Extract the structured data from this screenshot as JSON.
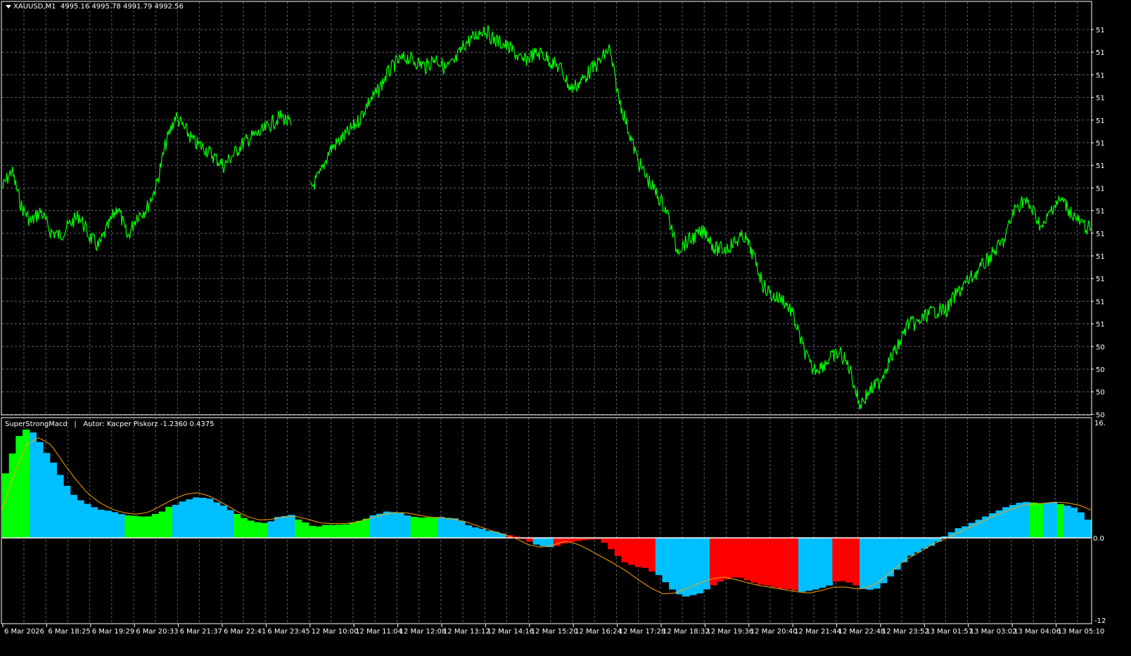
{
  "main": {
    "symbol_label": "XAUUSD,M1",
    "ohlc_label": "4995.16 4995.78 4991.79 4992.56",
    "price_axis_labels": [
      "51",
      "51",
      "51",
      "51",
      "51",
      "51",
      "51",
      "51",
      "51",
      "51",
      "51",
      "51",
      "51",
      "51",
      "50",
      "50",
      "50",
      "50",
      "50",
      "50"
    ],
    "line_color": "#00ff00"
  },
  "indicator": {
    "name_label": "SuperStrongMacd",
    "separator": "|",
    "info_label": "Autor: Kacper Piskorz -1.2360 0.4375",
    "axis_top": "16.",
    "axis_zero": "0.0",
    "axis_bottom": "-12",
    "colors": {
      "up_strong": "#00ff00",
      "weak": "#00bfff",
      "down_strong": "#ff0000",
      "signal": "#ffa500"
    }
  },
  "time_axis": [
    "6 Mar 2026",
    "6 Mar 18:25",
    "6 Mar 19:29",
    "6 Mar 20:33",
    "6 Mar 21:37",
    "6 Mar 22:41",
    "6 Mar 23:45",
    "12 Mar 10:00",
    "12 Mar 11:04",
    "12 Mar 12:08",
    "12 Mar 13:12",
    "12 Mar 14:16",
    "12 Mar 15:20",
    "12 Mar 16:24",
    "12 Mar 17:28",
    "12 Mar 18:32",
    "12 Mar 19:36",
    "12 Mar 20:40",
    "12 Mar 21:44",
    "12 Mar 22:48",
    "12 Mar 23:52",
    "13 Mar 01:57",
    "13 Mar 03:02",
    "13 Mar 04:06",
    "13 Mar 05:10"
  ],
  "chart_data": [
    {
      "type": "line",
      "title": "XAUUSD,M1",
      "series": [
        {
          "values": [
            5120,
            5128,
            5112,
            5105,
            5110,
            5101,
            5099,
            5104,
            5108,
            5099,
            5094,
            5103,
            5112,
            5098,
            5108,
            5111,
            5121,
            5140,
            5152,
            5146,
            5140,
            5138,
            5134,
            5130,
            5135,
            5140,
            5143,
            5145,
            5149,
            5152,
            5148,
            null,
            5120,
            5126,
            5137,
            5141,
            5145,
            5150,
            5158,
            5163,
            5171,
            5176,
            5178,
            5176,
            5174,
            5178,
            5173,
            5176,
            5184,
            5187,
            5191,
            5186,
            5184,
            5181,
            5176,
            5179,
            5180,
            5176,
            5173,
            5164,
            5167,
            5172,
            5176,
            5182,
            5160,
            5146,
            5132,
            5124,
            5117,
            5110,
            5093,
            5096,
            5099,
            5101,
            5093,
            5093,
            5096,
            5099,
            5090,
            5077,
            5072,
            5071,
            5065,
            5051,
            5040,
            5041,
            5045,
            5047,
            5040,
            5024,
            5030,
            5034,
            5043,
            5050,
            5060,
            5060,
            5064,
            5066,
            5066,
            5073,
            5078,
            5082,
            5087,
            5092,
            5097,
            5110,
            5115,
            5110,
            5102,
            5112,
            5115,
            5109,
            5104,
            5102
          ]
        }
      ],
      "x_start_label": "6 Mar 2026",
      "x_end_label": "13 Mar 05:10"
    },
    {
      "type": "area",
      "title": "SuperStrongMacd",
      "ylim": [
        -12,
        16
      ],
      "series": [
        {
          "values": [
            9,
            14,
            15.5,
            13,
            10.5,
            7.5,
            5.5,
            4.6,
            4,
            3.6,
            3.2,
            3.0,
            3.0,
            3.6,
            4.5,
            5.1,
            5.7,
            5.6,
            4.8,
            3.8,
            2.8,
            2.2,
            2.1,
            3.0,
            3.2,
            2.2,
            1.6,
            1.8,
            1.9,
            2.0,
            2.4,
            3.3,
            3.6,
            3.6,
            3.0,
            2.8,
            2.8,
            2.9,
            2.6,
            1.7,
            1.3,
            0.9,
            0.5,
            0.1,
            -0.5,
            -1.2,
            -1.5,
            -0.8,
            -0.5,
            -0.3,
            -0.2,
            -1.8,
            -3.5,
            -4.2,
            -4.6,
            -5.6,
            -7.6,
            -8.7,
            -8.5,
            -7.6,
            -6.6,
            -5.8,
            -6.0,
            -6.7,
            -7.1,
            -7.4,
            -7.7,
            -8.0,
            -7.8,
            -7.2,
            -6.4,
            -6.6,
            -7.5,
            -7.8,
            -6.5,
            -4.6,
            -2.8,
            -1.8,
            -1.0,
            0.2,
            1.2,
            1.9,
            2.7,
            3.4,
            4.2,
            4.8,
            5.0,
            4.8,
            5.0,
            4.7,
            4.2,
            2.6
          ]
        },
        {
          "values": [
            4,
            9,
            13,
            14,
            13,
            10.5,
            8.2,
            6.2,
            4.9,
            4,
            3.5,
            3.3,
            3.6,
            4.5,
            5.4,
            6.1,
            6.3,
            5.8,
            4.9,
            3.9,
            3.0,
            2.5,
            2.6,
            2.9,
            3.0,
            2.6,
            2.1,
            2.0,
            2.0,
            2.2,
            2.7,
            3.2,
            3.5,
            3.5,
            3.2,
            2.9,
            2.8,
            2.6,
            2.2,
            1.6,
            1.0,
            0.5,
            -0.1,
            -1.0,
            -1.4,
            -1.1,
            -0.5,
            -0.9,
            -1.8,
            -2.8,
            -3.8,
            -4.9,
            -6.2,
            -7.4,
            -8.3,
            -8.2,
            -7.5,
            -6.7,
            -6.1,
            -5.8,
            -6.2,
            -6.7,
            -7.1,
            -7.4,
            -7.7,
            -8.0,
            -8.2,
            -7.8,
            -7.3,
            -7.3,
            -7.6,
            -7.2,
            -6.1,
            -4.5,
            -3.1,
            -2.1,
            -1.0,
            -0.2,
            0.6,
            1.4,
            2.2,
            3.0,
            3.7,
            4.3,
            4.7,
            4.8,
            5.0,
            4.9,
            4.6,
            3.9
          ]
        }
      ],
      "color_segments": [
        {
          "from": 0,
          "to": 4,
          "color": "up_strong"
        },
        {
          "from": 4,
          "to": 18,
          "color": "weak"
        },
        {
          "from": 18,
          "to": 25,
          "color": "up_strong"
        },
        {
          "from": 25,
          "to": 34,
          "color": "weak"
        },
        {
          "from": 34,
          "to": 39,
          "color": "up_strong"
        },
        {
          "from": 39,
          "to": 43,
          "color": "weak"
        },
        {
          "from": 43,
          "to": 54,
          "color": "up_strong"
        },
        {
          "from": 54,
          "to": 60,
          "color": "weak"
        },
        {
          "from": 60,
          "to": 64,
          "color": "up_strong"
        },
        {
          "from": 64,
          "to": 74,
          "color": "weak"
        },
        {
          "from": 74,
          "to": 78,
          "color": "down_strong"
        },
        {
          "from": 78,
          "to": 81,
          "color": "weak"
        },
        {
          "from": 81,
          "to": 96,
          "color": "down_strong"
        },
        {
          "from": 96,
          "to": 104,
          "color": "weak"
        },
        {
          "from": 104,
          "to": 117,
          "color": "down_strong"
        },
        {
          "from": 117,
          "to": 122,
          "color": "weak"
        },
        {
          "from": 122,
          "to": 126,
          "color": "down_strong"
        },
        {
          "from": 126,
          "to": 151,
          "color": "weak"
        },
        {
          "from": 151,
          "to": 153,
          "color": "up_strong"
        },
        {
          "from": 153,
          "to": 155,
          "color": "weak"
        },
        {
          "from": 155,
          "to": 156,
          "color": "up_strong"
        },
        {
          "from": 156,
          "to": 160,
          "color": "weak"
        }
      ]
    }
  ]
}
